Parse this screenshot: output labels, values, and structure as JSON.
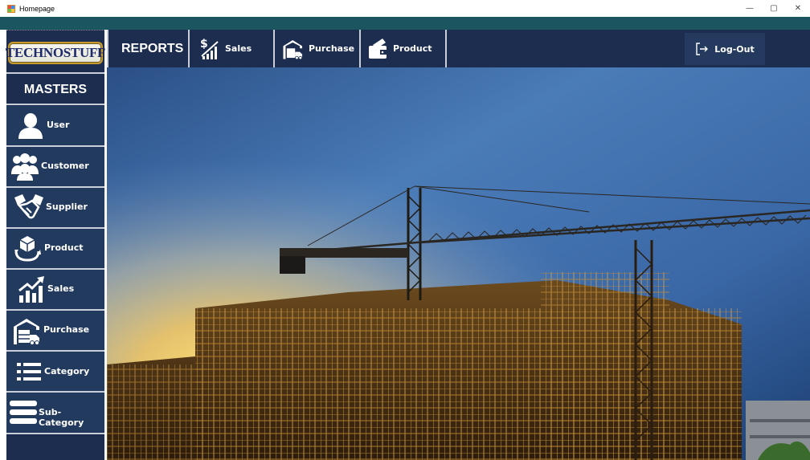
{
  "window": {
    "title": "Homepage",
    "minimize": "—",
    "restore": "▢",
    "close": "✕"
  },
  "logo": {
    "text": "TECHNOSTUFF"
  },
  "sidebar": {
    "heading": "MASTERS",
    "items": [
      {
        "label": "User",
        "icon": "user-icon"
      },
      {
        "label": "Customer",
        "icon": "customer-group-icon"
      },
      {
        "label": "Supplier",
        "icon": "handshake-icon"
      },
      {
        "label": "Product",
        "icon": "product-box-icon"
      },
      {
        "label": "Sales",
        "icon": "sales-chart-icon"
      },
      {
        "label": "Purchase",
        "icon": "warehouse-truck-icon"
      },
      {
        "label": "Category",
        "icon": "list-icon"
      },
      {
        "label": "Sub-Category",
        "icon": "stacked-bars-icon"
      }
    ]
  },
  "topnav": {
    "heading": "REPORTS",
    "items": [
      {
        "label": "Sales",
        "icon": "dollar-chart-icon"
      },
      {
        "label": "Purchase",
        "icon": "warehouse-truck-icon"
      },
      {
        "label": "Product",
        "icon": "product-wallet-icon"
      }
    ],
    "logout": {
      "label": "Log-Out",
      "icon": "logout-icon"
    }
  },
  "colors": {
    "navy": "#1c2d4f",
    "button": "#223a5e",
    "teal": "#1a5560",
    "separator": "#c9ced8",
    "logo_border": "#c99a2c"
  }
}
